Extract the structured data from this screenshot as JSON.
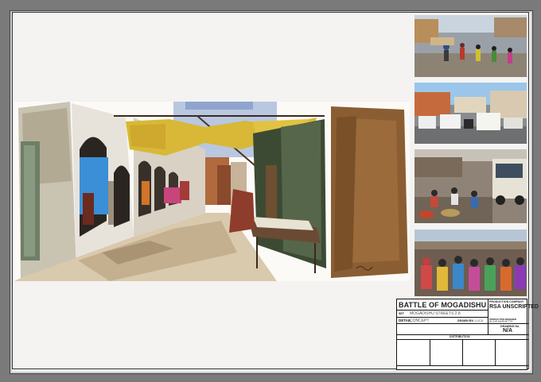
{
  "title_block": {
    "project_title": "BATTLE OF MOGADISHU",
    "production_company_label": "PRODUCTION COMPANY",
    "production_company": "RSA UNSCRIPTED",
    "set_label": "SET",
    "set_value": "MOGADISHU STREETS 2.8",
    "detail_label": "DETAIL",
    "detail_value": "CONCEPT",
    "drawn_by_label": "DRAWN BY",
    "drawn_by_value": "A.LUCA",
    "production_designer_label": "PRODUCTION DESIGNER",
    "production_designer": "BLAIR BARNETTE",
    "drawing_no_label": "DRAWING No.",
    "drawing_no": "N/A",
    "distribution_label": "DISTRIBUTION"
  },
  "images": {
    "concept_art": "street-concept-painting",
    "reference_1": "crowded-street-photo",
    "reference_2": "traffic-street-photo",
    "reference_3": "market-truck-photo",
    "reference_4": "crowded-market-photo"
  },
  "colors": {
    "awning": "#d8b836",
    "brown_wall": "#8a5e32",
    "sky": "#9fb4d6",
    "blue_cloth": "#3a8fd6"
  }
}
